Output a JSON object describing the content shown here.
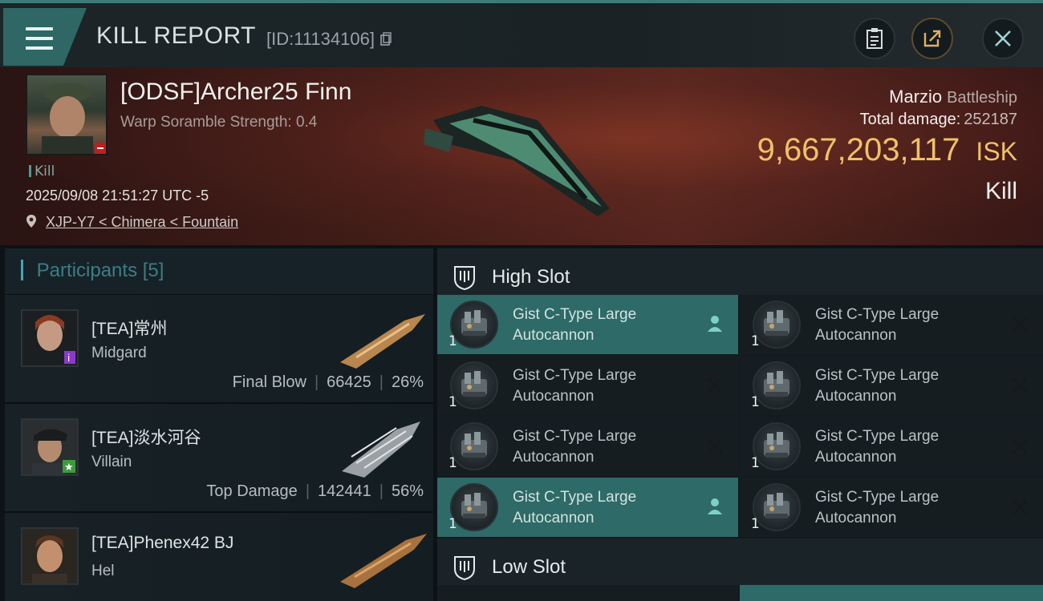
{
  "header": {
    "title": "KILL REPORT",
    "report_id": "[ID:11134106]"
  },
  "victim": {
    "name": "[ODSF]Archer25 Finn",
    "subtitle": "Warp Soramble Strength: 0.4",
    "tag": "Kill",
    "timestamp": "2025/09/08 21:51:27 UTC -5",
    "location": "XJP-Y7 < Chimera < Fountain",
    "ship_name": "Marzio",
    "ship_class": "Battleship",
    "total_damage_label": "Total damage:",
    "total_damage": "252187",
    "isk_value": "9,667,203,117",
    "isk_unit": "ISK",
    "result": "Kill"
  },
  "participants": {
    "label": "Participants",
    "count": "[5]",
    "items": [
      {
        "name": "[TEA]常州",
        "ship": "Midgard",
        "role": "Final Blow",
        "damage": "66425",
        "percent": "26%"
      },
      {
        "name": "[TEA]淡水河谷",
        "ship": "Villain",
        "role": "Top Damage",
        "damage": "142441",
        "percent": "56%"
      },
      {
        "name": "[TEA]Phenex42 BJ",
        "ship": "Hel"
      }
    ]
  },
  "slots": {
    "high_slot_label": "High Slot",
    "low_slot_label": "Low Slot",
    "high_items": [
      {
        "line1": "Gist C-Type Large",
        "line2": "Autocannon",
        "qty": "1",
        "state": "person"
      },
      {
        "line1": "Gist C-Type Large",
        "line2": "Autocannon",
        "qty": "1",
        "state": "destroyed"
      },
      {
        "line1": "Gist C-Type Large",
        "line2": "Autocannon",
        "qty": "1",
        "state": "destroyed"
      },
      {
        "line1": "Gist C-Type Large",
        "line2": "Autocannon",
        "qty": "1",
        "state": "destroyed"
      },
      {
        "line1": "Gist C-Type Large",
        "line2": "Autocannon",
        "qty": "1",
        "state": "destroyed"
      },
      {
        "line1": "Gist C-Type Large",
        "line2": "Autocannon",
        "qty": "1",
        "state": "destroyed"
      },
      {
        "line1": "Gist C-Type Large",
        "line2": "Autocannon",
        "qty": "1",
        "state": "person"
      },
      {
        "line1": "Gist C-Type Large",
        "line2": "Autocannon",
        "qty": "1",
        "state": "destroyed"
      }
    ]
  },
  "colors": {
    "accent_teal": "#2e6a67",
    "isk_gold": "#f0c06a",
    "banner_red": "#5e2a20"
  },
  "icons": [
    "menu-icon",
    "clipboard-icon",
    "share-icon",
    "close-icon",
    "location-pin-icon",
    "turret-icon",
    "shield-slot-icon",
    "person-icon",
    "x-icon"
  ]
}
